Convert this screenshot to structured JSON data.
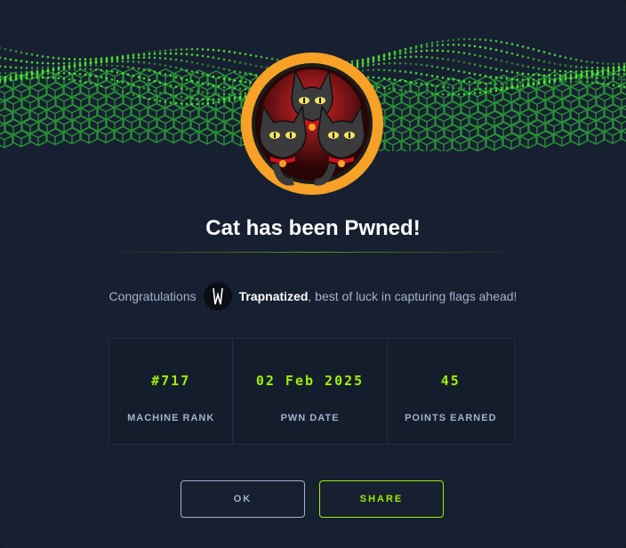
{
  "modal": {
    "title": "Cat has been Pwned!",
    "congrats_prefix": "Congratulations",
    "username": "Trapnatized",
    "congrats_suffix": ", best of luck in capturing flags ahead!"
  },
  "stats": [
    {
      "value": "#717",
      "label": "MACHINE RANK"
    },
    {
      "value": "02 Feb 2025",
      "label": "PWN DATE"
    },
    {
      "value": "45",
      "label": "POINTS EARNED"
    }
  ],
  "buttons": {
    "ok_label": "OK",
    "share_label": "SHARE"
  },
  "colors": {
    "background": "#172031",
    "accent": "#9fef00",
    "badge_ring": "#f7a126",
    "text_muted": "#a4b1cd"
  },
  "icons": {
    "machine_badge": "three-cats-badge",
    "user_avatar": "user-avatar-icon"
  }
}
